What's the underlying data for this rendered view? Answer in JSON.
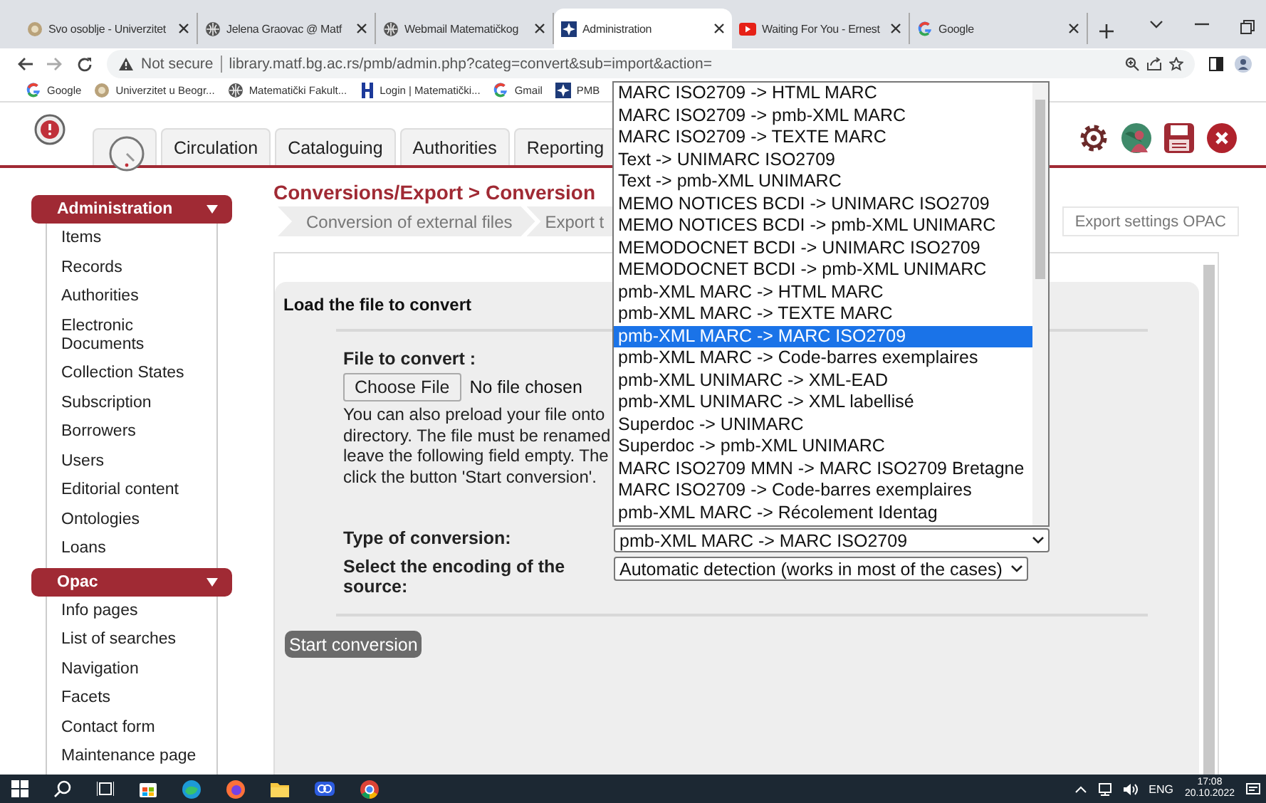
{
  "browser": {
    "tabs": [
      {
        "title": "Svo osoblje - Univerzitet",
        "selected": false
      },
      {
        "title": "Jelena Graovac @ Matf",
        "selected": false
      },
      {
        "title": "Webmail Matematičkog",
        "selected": false
      },
      {
        "title": "Administration",
        "selected": true
      },
      {
        "title": "Waiting For You - Ernest",
        "selected": false
      },
      {
        "title": "Google",
        "selected": false
      }
    ],
    "address": {
      "security": "Not secure",
      "url": "library.matf.bg.ac.rs/pmb/admin.php?categ=convert&sub=import&action="
    },
    "bookmarks": [
      "Google",
      "Univerzitet u Beogr...",
      "Matematički Fakult...",
      "Login | Matematički...",
      "Gmail",
      "PMB"
    ]
  },
  "app": {
    "tabs": [
      {
        "selected": false
      },
      {
        "label": "Circulation",
        "selected": false
      },
      {
        "label": "Cataloguing",
        "selected": false
      },
      {
        "label": "Authorities",
        "selected": false
      },
      {
        "label": "Reporting",
        "selected": false
      }
    ],
    "sidebar": [
      {
        "title": "Administration",
        "items": [
          "Items",
          "Records",
          "Authorities",
          "Electronic Documents",
          "Collection States",
          "Subscription",
          "Borrowers",
          "Users",
          "Editorial content",
          "Ontologies",
          "Loans"
        ]
      },
      {
        "title": "Opac",
        "items": [
          "Info pages",
          "List of searches",
          "Navigation",
          "Facets",
          "Contact form",
          "Maintenance page"
        ]
      }
    ],
    "title": "Conversions/Export > Conversion",
    "breadcrumb": [
      "Conversion of external files",
      "Export t",
      "Export settings OPAC"
    ],
    "panel": {
      "heading": "Load the file to convert",
      "file_label": "File to convert :",
      "file_button": "Choose File",
      "file_status": "No file chosen",
      "help_lines": [
        "You can also preload your file onto",
        "directory. The file must be renamed",
        "leave the following field empty. The",
        "click the button 'Start conversion'."
      ],
      "conversion_label": "Type of conversion:",
      "conversion_value": "pmb-XML MARC -> MARC ISO2709",
      "encoding_label": "Select the encoding of the source:",
      "encoding_value": "Automatic detection (works in most of the cases)",
      "start_button": "Start conversion"
    },
    "conversion_options": [
      {
        "label": "MARC ISO2709 -> HTML MARC",
        "selected": false
      },
      {
        "label": "MARC ISO2709 -> pmb-XML MARC",
        "selected": false
      },
      {
        "label": "MARC ISO2709 -> TEXTE MARC",
        "selected": false
      },
      {
        "label": "Text -> UNIMARC ISO2709",
        "selected": false
      },
      {
        "label": "Text -> pmb-XML UNIMARC",
        "selected": false
      },
      {
        "label": "MEMO NOTICES BCDI -> UNIMARC ISO2709",
        "selected": false
      },
      {
        "label": "MEMO NOTICES BCDI -> pmb-XML UNIMARC",
        "selected": false
      },
      {
        "label": "MEMODOCNET BCDI -> UNIMARC ISO2709",
        "selected": false
      },
      {
        "label": "MEMODOCNET BCDI -> pmb-XML UNIMARC",
        "selected": false
      },
      {
        "label": "pmb-XML MARC -> HTML MARC",
        "selected": false
      },
      {
        "label": "pmb-XML MARC -> TEXTE MARC",
        "selected": false
      },
      {
        "label": "pmb-XML MARC -> MARC ISO2709",
        "selected": true
      },
      {
        "label": "pmb-XML MARC -> Code-barres exemplaires",
        "selected": false
      },
      {
        "label": "pmb-XML UNIMARC -> XML-EAD",
        "selected": false
      },
      {
        "label": "pmb-XML UNIMARC -> XML labellisé",
        "selected": false
      },
      {
        "label": "Superdoc -> UNIMARC",
        "selected": false
      },
      {
        "label": "Superdoc -> pmb-XML UNIMARC",
        "selected": false
      },
      {
        "label": "MARC ISO2709 MMN -> MARC ISO2709 Bretagne",
        "selected": false
      },
      {
        "label": "MARC ISO2709 -> Code-barres exemplaires",
        "selected": false
      },
      {
        "label": "pmb-XML MARC -> Récolement Identag",
        "selected": false
      }
    ]
  },
  "taskbar": {
    "language": "ENG",
    "time": "17:08",
    "date": "20.10.2022"
  }
}
